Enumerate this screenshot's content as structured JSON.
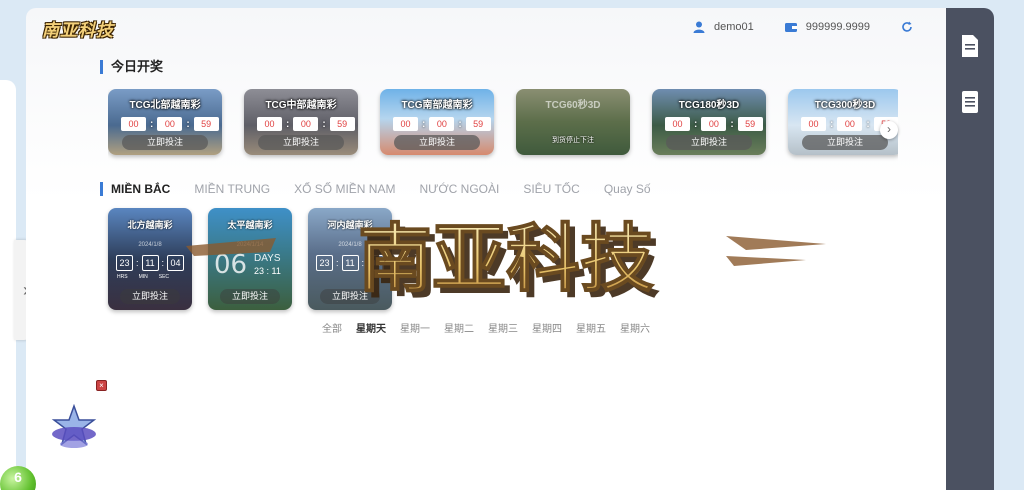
{
  "logo_text": "南亚科技",
  "topbar": {
    "username": "demo01",
    "balance": "999999.9999"
  },
  "today_section": {
    "title": "今日开奖"
  },
  "today_cards": [
    {
      "title": "TCG北部越南彩",
      "h": "00",
      "m": "00",
      "s": "59",
      "bet": "立即投注"
    },
    {
      "title": "TCG中部越南彩",
      "h": "00",
      "m": "00",
      "s": "59",
      "bet": "立即投注"
    },
    {
      "title": "TCG南部越南彩",
      "h": "00",
      "m": "00",
      "s": "59",
      "bet": "立即投注"
    },
    {
      "title": "TCG60秒3D",
      "stopped": "到货停止下注"
    },
    {
      "title": "TCG180秒3D",
      "h": "00",
      "m": "00",
      "s": "59",
      "bet": "立即投注"
    },
    {
      "title": "TCG300秒3D",
      "h": "00",
      "m": "00",
      "s": "59",
      "bet": "立即投注"
    }
  ],
  "region_tabs": [
    "MIỀN BẮC",
    "MIỀN TRUNG",
    "XỔ SỐ MIỀN NAM",
    "NƯỚC NGOÀI",
    "SIÊU TỐC",
    "Quay Số"
  ],
  "region_cards": [
    {
      "title": "北方越南彩",
      "date": "2024/1/8",
      "h": "23",
      "m": "11",
      "s": "04",
      "u1": "HRS",
      "u2": "MIN",
      "u3": "SEC",
      "bet": "立即投注"
    },
    {
      "title": "太平越南彩",
      "date": "2024/1/14",
      "days": "06",
      "days_label": "DAYS",
      "time": "23 : 11",
      "bet": "立即投注"
    },
    {
      "title": "河内越南彩",
      "date": "2024/1/8",
      "h": "23",
      "m": "11",
      "s": "04",
      "bet": "立即投注"
    }
  ],
  "weekdays": [
    "全部",
    "星期天",
    "星期一",
    "星期二",
    "星期三",
    "星期四",
    "星期五",
    "星期六"
  ],
  "watermark_text": "南亚科技",
  "lottery_ball": "6"
}
